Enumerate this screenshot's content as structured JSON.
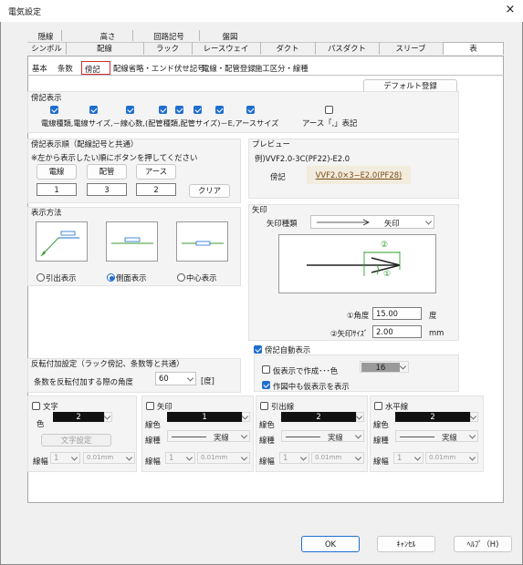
{
  "window": {
    "title": "電気設定",
    "close_icon": "×"
  },
  "tabs_top": [
    "隠線",
    "高さ",
    "回路記号",
    "盤図"
  ],
  "tabs_bottom": [
    "シンボル",
    "配線",
    "ラック",
    "レースウェイ",
    "ダクト",
    "パスダクト",
    "スリーブ",
    "表"
  ],
  "subtabs": [
    "基本",
    "条数",
    "傍記",
    "配線省略・エンド伏せ記号",
    "電線・配管登録",
    "施工区分・線種"
  ],
  "default_button": "デフォルト登録",
  "boki_display": {
    "title": "傍記表示",
    "items": [
      "電線種類",
      "電線サイズ",
      "－",
      "線心数",
      "(",
      "配管種類",
      "配管サイズ",
      ")",
      "－",
      "E",
      "アースサイズ"
    ],
    "caption": "電線種類,電線サイズ,－線心数,(配管種類,配管サイズ)－E,アースサイズ",
    "earth_label": "アース「,」表記"
  },
  "order": {
    "title": "傍記表示順（配線記号と共通）",
    "hint": "※左から表示したい順にボタンを押してください",
    "buttons": [
      "電線",
      "配管",
      "アース"
    ],
    "values": [
      "1",
      "3",
      "2"
    ],
    "clear": "クリア"
  },
  "preview": {
    "title": "プレビュー",
    "example": "例)VVF2.0-3C(PF22)-E2.0",
    "label": "傍記",
    "text": "VVF2.0×3−E2.0(PF28)"
  },
  "method": {
    "title": "表示方法",
    "options": [
      "引出表示",
      "側面表示",
      "中心表示"
    ],
    "selected": 1
  },
  "arrow": {
    "title": "矢印",
    "type_label": "矢印種類",
    "type_value": "矢印",
    "angle_label": "①角度",
    "angle_value": "15.00",
    "angle_unit": "度",
    "size_label": "②矢印ｻｲｽﾞ",
    "size_value": "2.00",
    "size_unit": "mm",
    "mark1": "①",
    "mark2": "②"
  },
  "rotate": {
    "title": "反転付加設定（ラック傍記、条数等と共通）",
    "label": "条数を反転付加する際の角度",
    "value": "60",
    "unit": "[度]"
  },
  "auto": {
    "title": "傍記自動表示",
    "provisional": "仮表示で作成･･･色",
    "color_value": "16",
    "in_drawing": "作図中も仮表示を表示"
  },
  "props": [
    {
      "title": "文字",
      "color_label": "色",
      "color": "2",
      "button": "文字設定",
      "width_label": "線幅",
      "width": "1",
      "width_mm": "0.01mm"
    },
    {
      "title": "矢印",
      "color_label": "線色",
      "color": "1",
      "type_label": "線種",
      "type": "実線",
      "width_label": "線幅",
      "width": "1",
      "width_mm": "0.01mm"
    },
    {
      "title": "引出線",
      "color_label": "線色",
      "color": "2",
      "type_label": "線種",
      "type": "実線",
      "width_label": "線幅",
      "width": "1",
      "width_mm": "0.01mm"
    },
    {
      "title": "水平線",
      "color_label": "線色",
      "color": "2",
      "type_label": "線種",
      "type": "実線",
      "width_label": "線幅",
      "width": "1",
      "width_mm": "0.01mm"
    }
  ],
  "footer": {
    "ok": "OK",
    "cancel": "ｷｬﾝｾﾙ",
    "help": "ﾍﾙﾌﾟ（H)"
  }
}
